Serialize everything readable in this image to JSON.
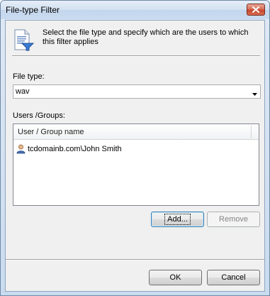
{
  "window": {
    "title": "File-type Filter",
    "close_icon": "close-icon"
  },
  "header": {
    "icon": "document-filter-icon",
    "description": "Select the file type and specify which are the users to which this filter applies"
  },
  "file_type": {
    "label": "File type:",
    "value": "wav"
  },
  "users": {
    "label": "Users /Groups:",
    "column_header": "User / Group name",
    "rows": [
      {
        "icon": "user-icon",
        "name": "tcdomainb.com\\John Smith"
      }
    ],
    "add_label": "Add...",
    "remove_label": "Remove"
  },
  "footer": {
    "ok_label": "OK",
    "cancel_label": "Cancel"
  },
  "colors": {
    "title_gradient_top": "#e6eef8",
    "close_red": "#c7452c",
    "client_bg": "#f0f0f0",
    "focus_border": "#3c7fb1"
  }
}
